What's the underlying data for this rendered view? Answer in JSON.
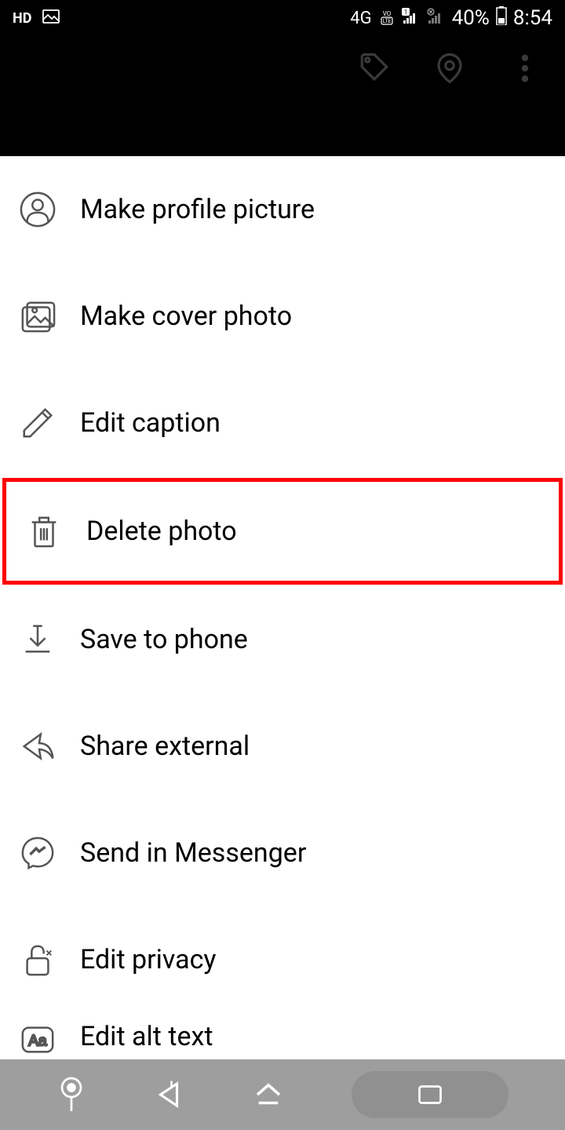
{
  "status": {
    "hd": "HD",
    "network": "4G",
    "battery": "40%",
    "time": "8:54"
  },
  "menu": {
    "items": [
      {
        "label": "Make profile picture",
        "highlighted": false
      },
      {
        "label": "Make cover photo",
        "highlighted": false
      },
      {
        "label": "Edit caption",
        "highlighted": false
      },
      {
        "label": "Delete photo",
        "highlighted": true
      },
      {
        "label": "Save to phone",
        "highlighted": false
      },
      {
        "label": "Share external",
        "highlighted": false
      },
      {
        "label": "Send in Messenger",
        "highlighted": false
      },
      {
        "label": "Edit privacy",
        "highlighted": false
      },
      {
        "label": "Edit alt text",
        "highlighted": false
      }
    ]
  }
}
